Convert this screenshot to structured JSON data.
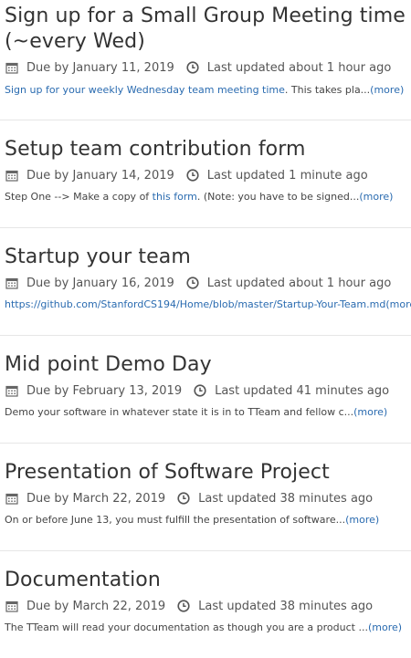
{
  "colors": {
    "title": "#333333",
    "meta": "#555555",
    "link": "#2a6bb0",
    "divider": "#e6e6e6"
  },
  "assignments": [
    {
      "title": "Sign up for a Small Group Meeting time (~every Wed)",
      "due": "Due by January 11, 2019",
      "updated": "Last updated about 1 hour ago",
      "desc_link": "Sign up for your weekly Wednesday team meeting time",
      "desc_text": ". This takes pla...",
      "more": "(more)"
    },
    {
      "title": "Setup team contribution form",
      "due": "Due by January 14, 2019",
      "updated": "Last updated 1 minute ago",
      "desc_pre": "Step One --> Make a copy of ",
      "desc_link": "this form",
      "desc_text": ". (Note: you have to be signed...",
      "more": "(more)"
    },
    {
      "title": "Startup your team",
      "due": "Due by January 16, 2019",
      "updated": "Last updated about 1 hour ago",
      "desc_link": "https://github.com/StanfordCS194/Home/blob/master/Startup-Your-Team.md",
      "more": "(more)"
    },
    {
      "title": "Mid point Demo Day",
      "due": "Due by February 13, 2019",
      "updated": "Last updated 41 minutes ago",
      "desc_text": "Demo your software in whatever state it is in to TTeam and fellow c...",
      "more": "(more)"
    },
    {
      "title": "Presentation of Software Project",
      "due": "Due by March 22, 2019",
      "updated": "Last updated 38 minutes ago",
      "desc_text": "On or before June 13, you must fulfill the presentation of software...",
      "more": "(more)"
    },
    {
      "title": "Documentation",
      "due": "Due by March 22, 2019",
      "updated": "Last updated 38 minutes ago",
      "desc_text": "The TTeam will read your documentation as though you are a product ...",
      "more": "(more)"
    }
  ],
  "icons": {
    "calendar": "calendar-icon",
    "clock": "clock-icon"
  }
}
